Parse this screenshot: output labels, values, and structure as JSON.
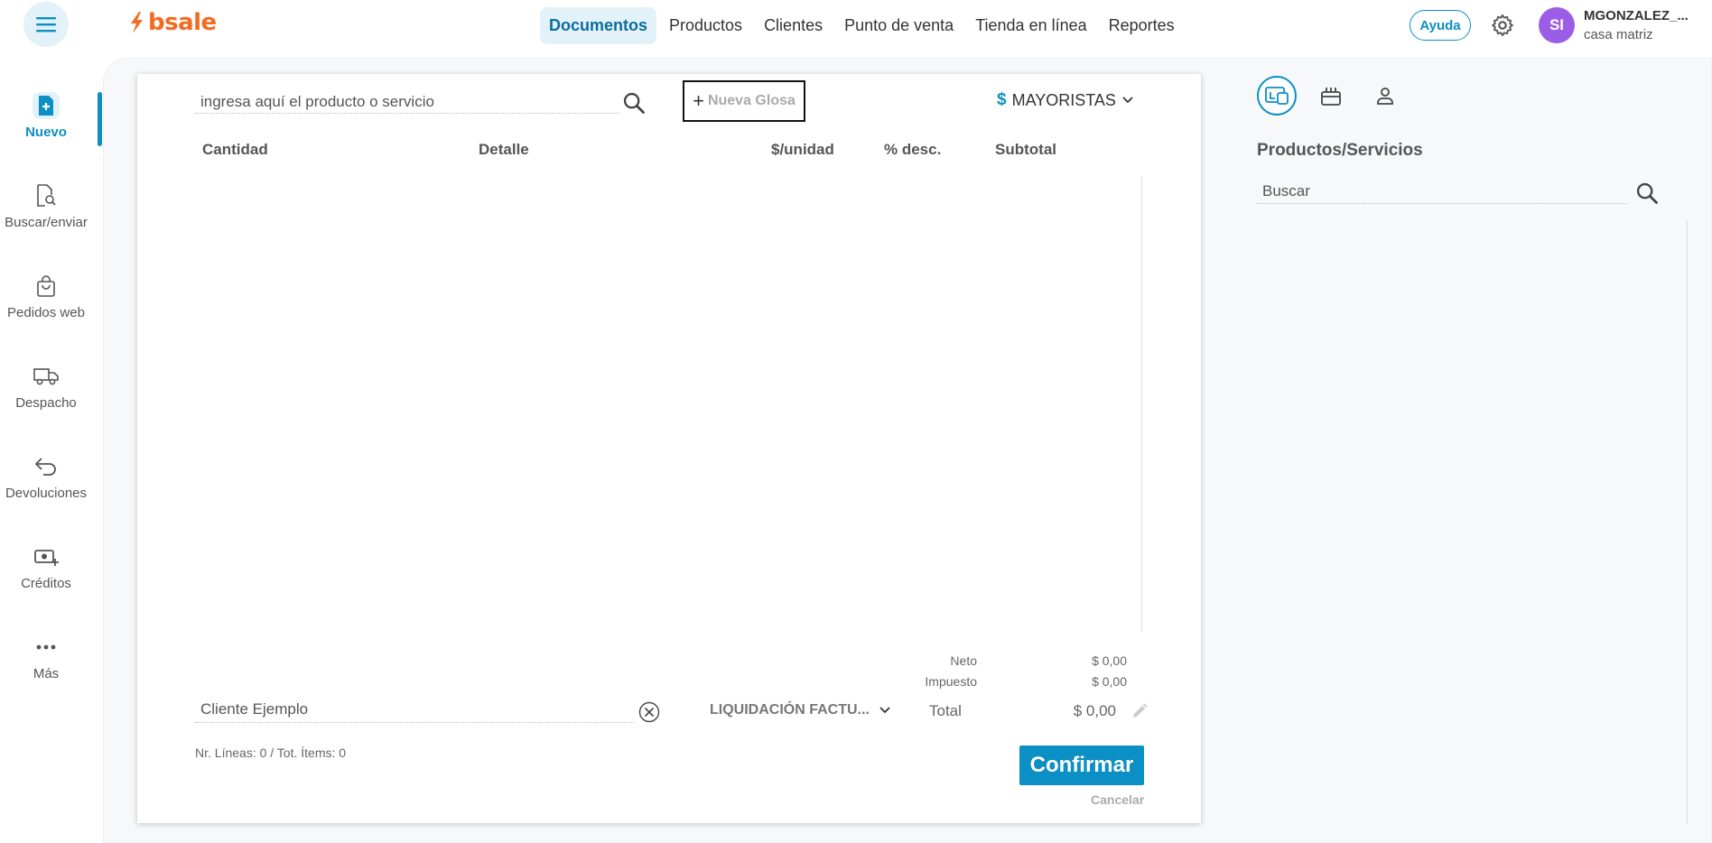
{
  "header": {
    "logo_text": "bsale",
    "nav": [
      {
        "label": "Documentos",
        "active": true
      },
      {
        "label": "Productos",
        "active": false
      },
      {
        "label": "Clientes",
        "active": false
      },
      {
        "label": "Punto de venta",
        "active": false
      },
      {
        "label": "Tienda en línea",
        "active": false
      },
      {
        "label": "Reportes",
        "active": false
      }
    ],
    "help_label": "Ayuda",
    "avatar_initials": "SI",
    "user_name": "MGONZALEZ_...",
    "user_branch": "casa matriz"
  },
  "sidebar": {
    "items": [
      {
        "label": "Nuevo",
        "icon": "new-document-icon",
        "active": true
      },
      {
        "label": "Buscar/enviar",
        "icon": "search-document-icon",
        "active": false
      },
      {
        "label": "Pedidos web",
        "icon": "shopping-bag-icon",
        "active": false
      },
      {
        "label": "Despacho",
        "icon": "truck-icon",
        "active": false
      },
      {
        "label": "Devoluciones",
        "icon": "return-arrow-icon",
        "active": false
      },
      {
        "label": "Créditos",
        "icon": "cash-plus-icon",
        "active": false
      },
      {
        "label": "Más",
        "icon": "more-dots-icon",
        "active": false
      }
    ]
  },
  "document": {
    "product_search_value": "ingresa aquí el producto o servicio",
    "new_gloss_label": "Nueva Glosa",
    "price_list_symbol": "$",
    "price_list_label": "MAYORISTAS",
    "columns": [
      "Cantidad",
      "Detalle",
      "$/unidad",
      "% desc.",
      "Subtotal"
    ],
    "summary": {
      "neto_label": "Neto",
      "neto_value": "$ 0,00",
      "impuesto_label": "Impuesto",
      "impuesto_value": "$ 0,00",
      "total_label": "Total",
      "total_value": "$ 0,00"
    },
    "client_value": "Cliente Ejemplo",
    "doc_type_label": "LIQUIDACIÓN FACTU...",
    "line_count_text": "Nr. Líneas: 0 / Tot. Ítems: 0",
    "confirm_label": "Confirmar",
    "cancel_label": "Cancelar"
  },
  "right_panel": {
    "tabs": [
      {
        "icon": "product-catalog-icon",
        "active": true
      },
      {
        "icon": "gift-box-icon",
        "active": false
      },
      {
        "icon": "person-icon",
        "active": false
      }
    ],
    "title": "Productos/Servicios",
    "search_value": "Buscar"
  },
  "colors": {
    "accent": "#0b8fc4",
    "brand": "#f26b21",
    "avatar": "#9b5de5"
  }
}
